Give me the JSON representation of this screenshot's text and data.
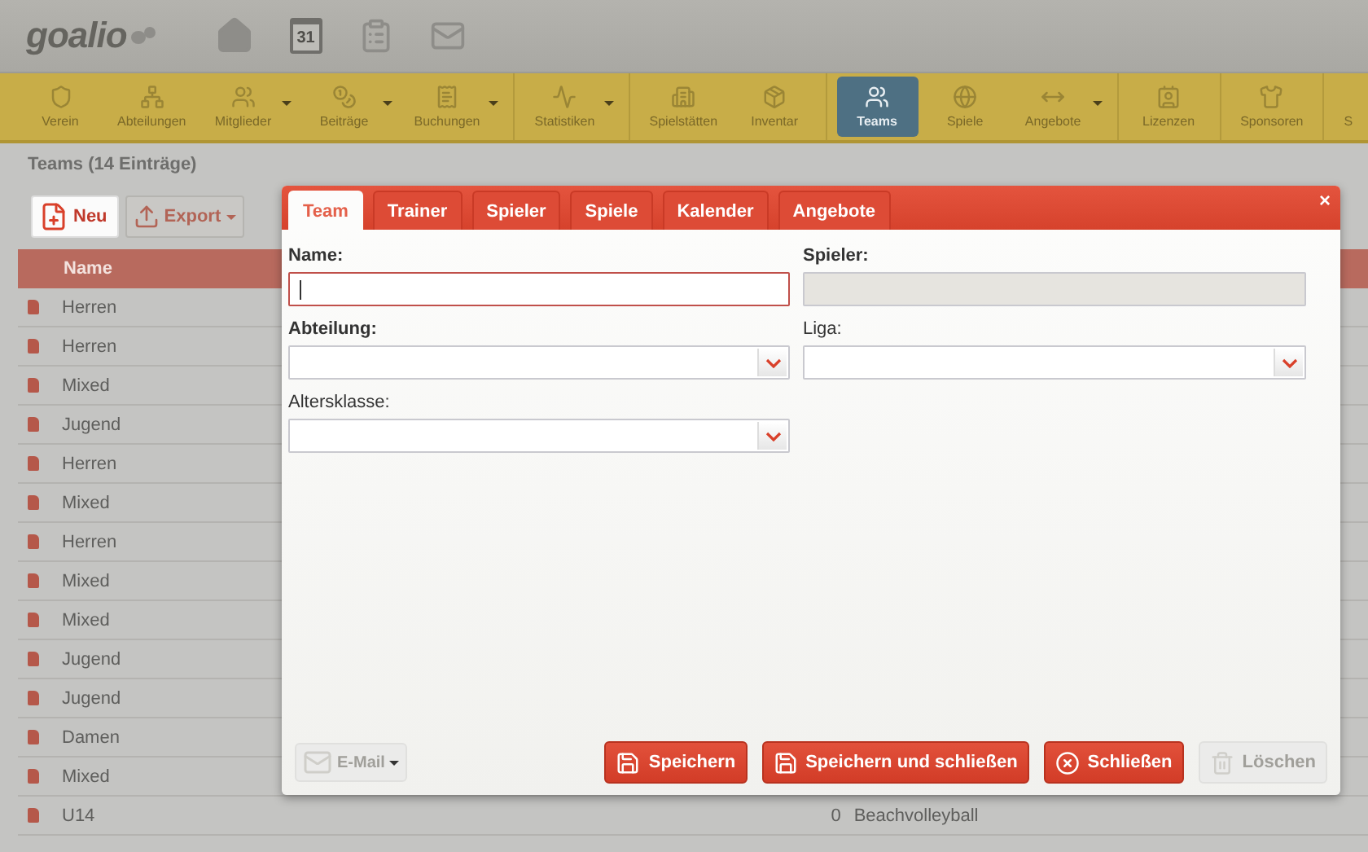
{
  "header": {
    "logo": "goalio",
    "calendar_day": "31"
  },
  "toolbar": {
    "groups": [
      [
        {
          "label": "Verein",
          "dropdown": false,
          "selected": false
        },
        {
          "label": "Abteilungen",
          "dropdown": false,
          "selected": false
        },
        {
          "label": "Mitglieder",
          "dropdown": true,
          "selected": false
        },
        {
          "label": "Beiträge",
          "dropdown": true,
          "selected": false
        },
        {
          "label": "Buchungen",
          "dropdown": true,
          "selected": false
        }
      ],
      [
        {
          "label": "Statistiken",
          "dropdown": true,
          "selected": false
        }
      ],
      [
        {
          "label": "Spielstätten",
          "dropdown": false,
          "selected": false
        },
        {
          "label": "Inventar",
          "dropdown": false,
          "selected": false
        }
      ],
      [
        {
          "label": "Teams",
          "dropdown": false,
          "selected": true
        },
        {
          "label": "Spiele",
          "dropdown": false,
          "selected": false
        },
        {
          "label": "Angebote",
          "dropdown": true,
          "selected": false
        }
      ],
      [
        {
          "label": "Lizenzen",
          "dropdown": false,
          "selected": false
        }
      ],
      [
        {
          "label": "Sponsoren",
          "dropdown": false,
          "selected": false
        }
      ],
      [
        {
          "label": "S",
          "dropdown": false,
          "selected": false
        }
      ]
    ]
  },
  "page": {
    "title": "Teams (14 Einträge)",
    "new_button": "Neu",
    "export_button": "Export"
  },
  "table": {
    "columns": [
      "Name"
    ],
    "rows": [
      {
        "name": "Herren"
      },
      {
        "name": "Herren"
      },
      {
        "name": "Mixed"
      },
      {
        "name": "Jugend"
      },
      {
        "name": "Herren"
      },
      {
        "name": "Mixed"
      },
      {
        "name": "Herren"
      },
      {
        "name": "Mixed"
      },
      {
        "name": "Mixed"
      },
      {
        "name": "Jugend"
      },
      {
        "name": "Jugend"
      },
      {
        "name": "Damen"
      },
      {
        "name": "Mixed"
      },
      {
        "name": "U14",
        "column_3": "0",
        "column_4": "Beachvolleyball"
      }
    ]
  },
  "dialog": {
    "close": "×",
    "tabs": [
      {
        "label": "Team",
        "selected": true
      },
      {
        "label": "Trainer",
        "selected": false
      },
      {
        "label": "Spieler",
        "selected": false
      },
      {
        "label": "Spiele",
        "selected": false
      },
      {
        "label": "Kalender",
        "selected": false
      },
      {
        "label": "Angebote",
        "selected": false
      }
    ],
    "fields": [
      {
        "label": "Name:",
        "kind": "text",
        "emphasized": true,
        "focused": true,
        "disabled": false
      },
      {
        "label": "Spieler:",
        "kind": "text",
        "emphasized": true,
        "focused": false,
        "disabled": true
      },
      {
        "label": "Abteilung:",
        "kind": "select",
        "emphasized": true,
        "focused": false,
        "disabled": false
      },
      {
        "label": "Liga:",
        "kind": "select",
        "emphasized": false,
        "focused": false,
        "disabled": false
      },
      {
        "label": "Altersklasse:",
        "kind": "select",
        "emphasized": false,
        "focused": false,
        "disabled": false
      }
    ],
    "email_button": {
      "label": "E-Mail",
      "disabled": true
    },
    "buttons": [
      {
        "label": "Speichern",
        "kind": "save",
        "disabled": false
      },
      {
        "label": "Speichern und schließen",
        "kind": "save-close",
        "disabled": false
      },
      {
        "label": "Schließen",
        "kind": "close",
        "disabled": false
      },
      {
        "label": "Löschen",
        "kind": "delete",
        "disabled": true
      }
    ]
  }
}
